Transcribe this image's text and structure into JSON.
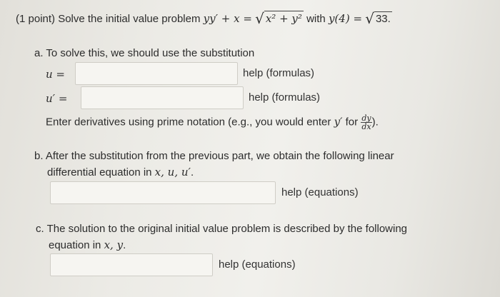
{
  "problem": {
    "prefix": "(1 point) Solve the initial value problem",
    "equation_lhs": "yy′ + x =",
    "sqrt_content": "x² + y²",
    "with_text": "with",
    "initial_condition_lhs": "y(4) =",
    "initial_condition_rhs": "33."
  },
  "part_a": {
    "label": "a. To solve this, we should use the substitution",
    "u_label": "u =",
    "u_prime_label": "u′ =",
    "help_u": "help (formulas)",
    "help_u_prime": "help (formulas)",
    "note_prefix": "Enter derivatives using prime notation (e.g., you would enter",
    "note_y_prime": "y′",
    "note_for": "for",
    "note_frac_num": "dy",
    "note_frac_den": "dx",
    "note_suffix": ")."
  },
  "part_b": {
    "line1": "b. After the substitution from the previous part, we obtain the following linear",
    "line2_prefix": "differential equation in",
    "line2_vars": "x, u, u′",
    "line2_suffix": ".",
    "help": "help (equations)"
  },
  "part_c": {
    "line1": "c. The solution to the original initial value problem is described by the following",
    "line2_prefix": "equation in",
    "line2_vars": "x, y",
    "line2_suffix": ".",
    "help": "help (equations)"
  },
  "inputs": {
    "u_value": "",
    "u_prime_value": "",
    "part_b_value": "",
    "part_c_value": ""
  }
}
